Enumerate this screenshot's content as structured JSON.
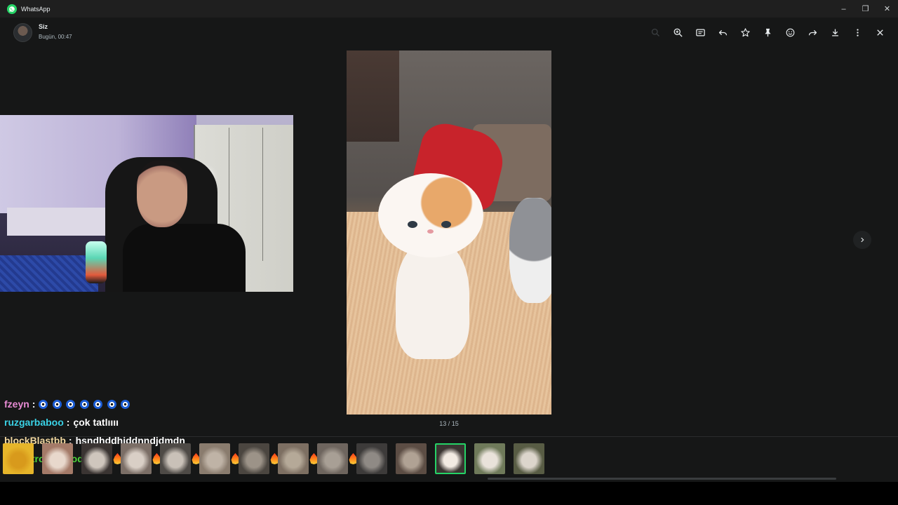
{
  "window": {
    "title": "WhatsApp",
    "controls": {
      "minimize": "–",
      "restore": "❐",
      "close": "✕"
    }
  },
  "header": {
    "sender_name": "Siz",
    "sender_time": "Bugün, 00:47"
  },
  "toolbar": {
    "icons": [
      "search-icon",
      "zoom-in-icon",
      "caption-icon",
      "reply-icon",
      "star-icon",
      "pin-icon",
      "emoji-icon",
      "forward-icon",
      "download-icon",
      "more-icon",
      "close-icon"
    ]
  },
  "viewer": {
    "counter": "13 / 15",
    "accent_color": "#25d366"
  },
  "chat_overlay": {
    "lines": [
      {
        "user": "fzeyn",
        "sep": ":",
        "msg": "",
        "user_color": "#e88bd4",
        "emoji": "eye",
        "emoji_count": 7
      },
      {
        "user": "ruzgarbaboo",
        "sep": ":",
        "msg": "çok tatlıııı",
        "user_color": "#3ad2e6"
      },
      {
        "user": "blockBlastbb",
        "sep": ":",
        "msg": "hsndhddhjddnndjdmdn",
        "user_color": "#f2d8a0"
      },
      {
        "user": "Ahmetrobinhood",
        "sep": ":",
        "msg": "",
        "user_color": "#4cd63a",
        "emoji": "fire",
        "emoji_count": 14
      }
    ]
  },
  "thumbnails": [
    {
      "index": 1,
      "colors": [
        "#e6b52a",
        "#d89a1c"
      ]
    },
    {
      "index": 2,
      "colors": [
        "#a47a68",
        "#e8d8cc"
      ]
    },
    {
      "index": 3,
      "colors": [
        "#3a3432",
        "#cfc6bd"
      ]
    },
    {
      "index": 4,
      "colors": [
        "#7b6e66",
        "#d9cfc6"
      ]
    },
    {
      "index": 5,
      "colors": [
        "#4e4a46",
        "#c9c1b8"
      ]
    },
    {
      "index": 6,
      "colors": [
        "#8a7c6e",
        "#bfb3a6"
      ]
    },
    {
      "index": 7,
      "colors": [
        "#4b4640",
        "#9c9388"
      ]
    },
    {
      "index": 8,
      "colors": [
        "#7d6f62",
        "#b5a998"
      ]
    },
    {
      "index": 9,
      "colors": [
        "#6e655e",
        "#a89f95"
      ]
    },
    {
      "index": 10,
      "colors": [
        "#3d3b3a",
        "#8f8a85"
      ]
    },
    {
      "index": 11,
      "colors": [
        "#5c4d44",
        "#b0a294"
      ]
    },
    {
      "index": 12,
      "colors": [
        "#3a3431",
        "#f3ebe3"
      ],
      "selected": true
    },
    {
      "index": 13,
      "colors": [
        "#6f7a5a",
        "#e9e2da"
      ]
    },
    {
      "index": 14,
      "colors": [
        "#585c44",
        "#dcd5cc"
      ]
    }
  ]
}
